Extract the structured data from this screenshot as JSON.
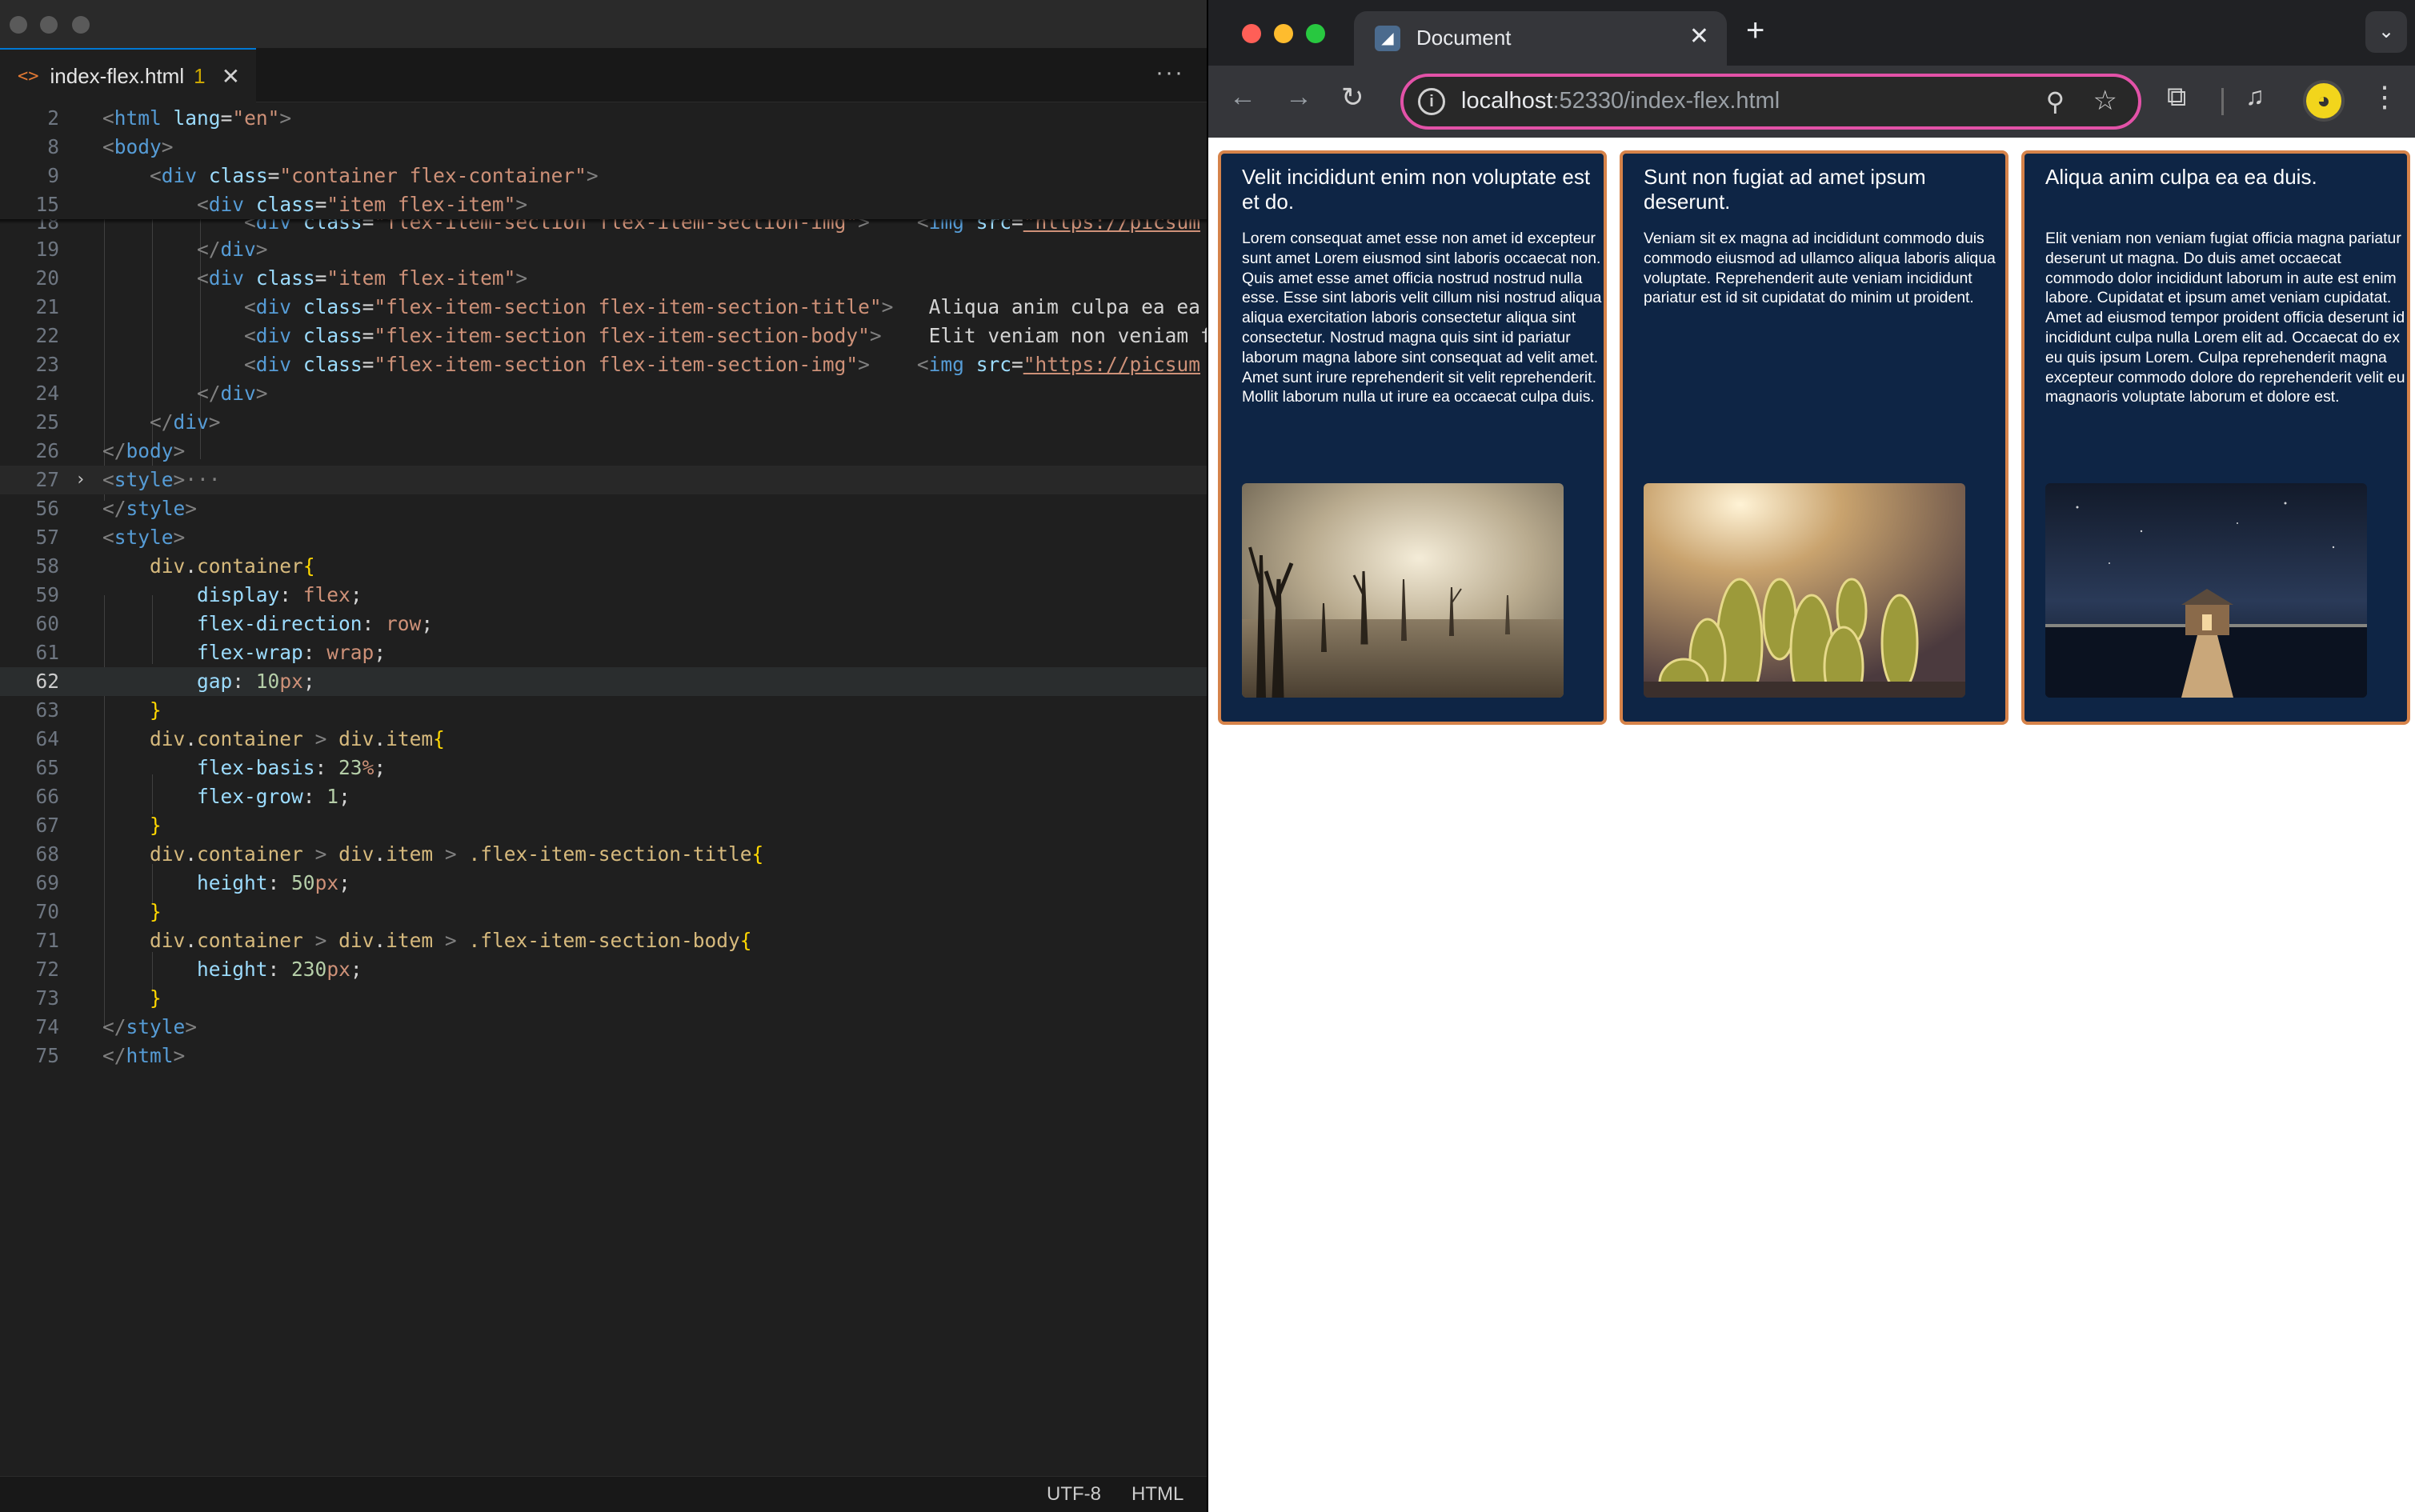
{
  "editor": {
    "tab": {
      "icon": "<>",
      "name": "index-flex.html",
      "problems": "1",
      "close": "✕"
    },
    "more": "···",
    "status": {
      "encoding": "UTF-8",
      "language": "HTML"
    }
  },
  "browser": {
    "tab_title": "Document",
    "favicon": "◢",
    "url_host": "localhost",
    "url_rest": ":52330/index-flex.html",
    "cards": [
      {
        "title": "Velit incididunt enim non voluptate est et do.",
        "body": "Lorem consequat amet esse non amet id excepteur sunt amet Lorem eiusmod sint laboris occaecat non. Quis amet esse amet officia nostrud nostrud nulla esse. Esse sint laboris velit cillum nisi nostrud aliqua aliqua exercitation laboris consectetur aliqua sint consectetur. Nostrud magna quis sint id pariatur laborum magna labore sint consequat ad velit amet. Amet sunt irure reprehenderit sit velit reprehenderit. Mollit laborum nulla ut irure ea occaecat culpa duis.",
        "image": "foggy-dead-trees"
      },
      {
        "title": "Sunt non fugiat ad amet ipsum deserunt.",
        "body": "Veniam sit ex magna ad incididunt commodo duis commodo eiusmod ad ullamco aliqua laboris aliqua voluptate. Reprehenderit aute veniam incididunt pariatur est id sit cupidatat do minim ut proident.",
        "image": "cactus-sunlight"
      },
      {
        "title": "Aliqua anim culpa ea ea duis.",
        "body": "Elit veniam non veniam fugiat officia magna pariatur deserunt ut magna. Do duis amet occaecat commodo dolor incididunt laborum in aute est enim labore. Cupidatat et ipsum amet veniam cupidatat. Amet ad eiusmod tempor proident officia deserunt id incididunt culpa nulla Lorem elit ad. Occaecat do ex eu quis ipsum Lorem. Culpa reprehenderit magna excepteur commodo dolore do reprehenderit velit eu magnaoris voluptate laborum et dolore est.",
        "image": "boathouse-night"
      }
    ]
  },
  "colors": {
    "card_bg": "#0e2545",
    "card_border": "#d6834a",
    "omnibox_border": "#e352a8"
  }
}
